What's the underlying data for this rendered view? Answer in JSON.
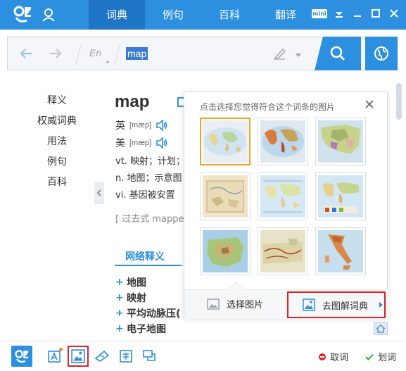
{
  "topbar": {
    "tabs": [
      {
        "label": "词典",
        "active": true
      },
      {
        "label": "例句",
        "active": false
      },
      {
        "label": "百科",
        "active": false
      },
      {
        "label": "翻译",
        "active": false
      }
    ],
    "mini_label": "mini"
  },
  "search": {
    "lang": "En",
    "query": "map"
  },
  "sidenav": {
    "items": [
      "释义",
      "权威词典",
      "用法",
      "例句",
      "百科"
    ]
  },
  "entry": {
    "word": "map",
    "pron_uk_label": "英",
    "pron_uk_ipa": "[mæp]",
    "pron_us_label": "美",
    "pron_us_ipa": "[mæp]",
    "def_vt": "vt. 映射；计划；",
    "def_n": "n. 地图；示意图",
    "def_vi": "vi. 基因被安置",
    "past_tense": "[ 过去式 mappec"
  },
  "web": {
    "title": "网络释义",
    "items": [
      "地图",
      "映射",
      "平均动脉压(",
      "电子地图"
    ]
  },
  "popup": {
    "title": "点击选择您觉得符合这个词条的图片",
    "choose_label": "选择图片",
    "goto_label": "去图解词典",
    "selected_index": 0,
    "thumb_count": 9
  },
  "bottombar": {
    "cancel_label": "取词",
    "select_label": "划词"
  },
  "colors": {
    "brand": "#2c8fe0",
    "brand_dark": "#1f76c6",
    "highlight": "#e0202a",
    "selected": "#f0a020"
  }
}
